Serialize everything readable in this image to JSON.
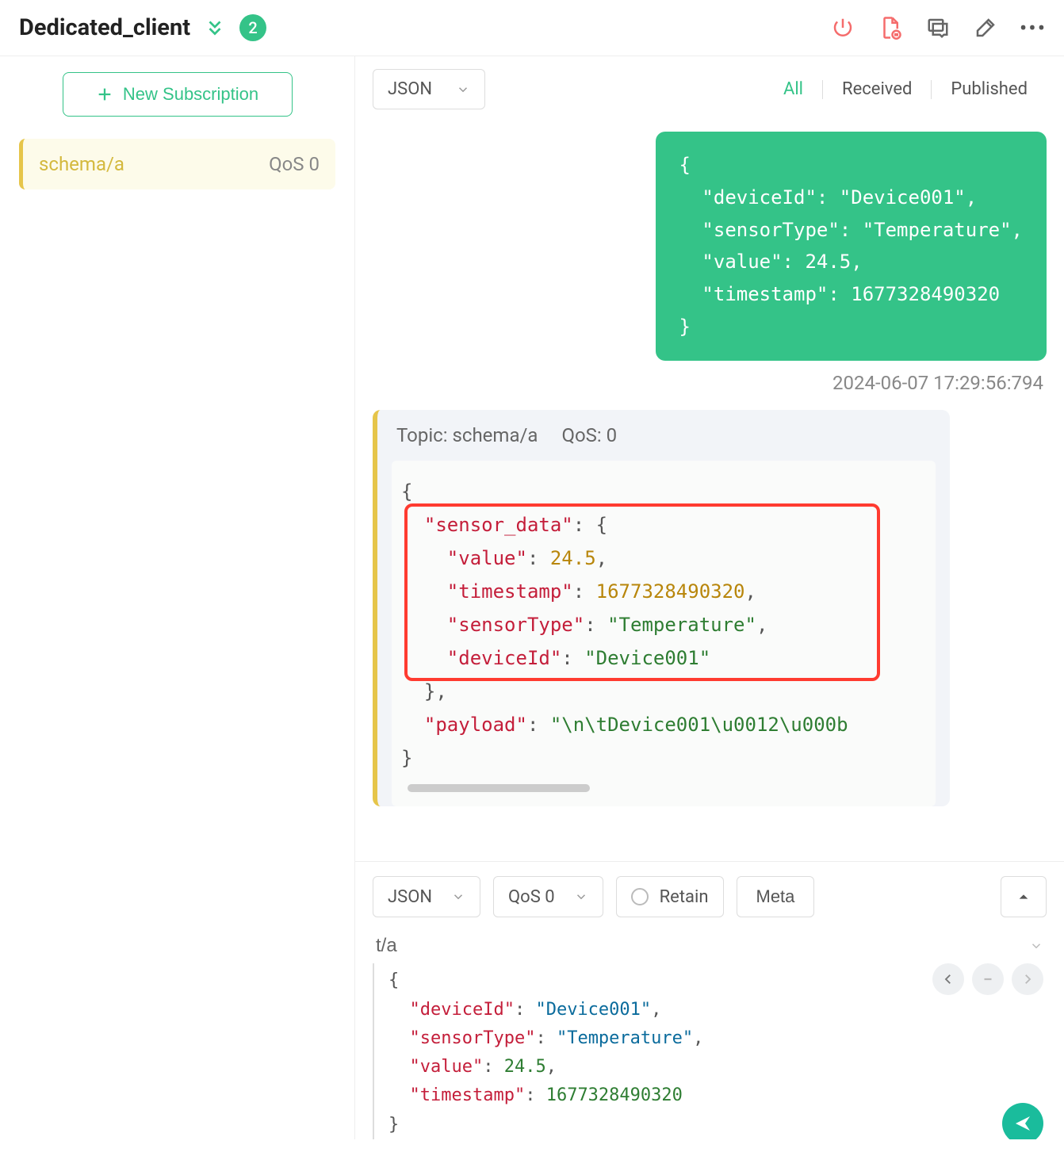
{
  "header": {
    "title": "Dedicated_client",
    "badge": "2"
  },
  "sidebar": {
    "new_subscription": "New Subscription",
    "items": [
      {
        "topic": "schema/a",
        "qos": "QoS 0"
      }
    ]
  },
  "content": {
    "format_select": "JSON",
    "tabs": {
      "all": "All",
      "received": "Received",
      "published": "Published"
    }
  },
  "messages": {
    "sent": {
      "body": "{\n  \"deviceId\": \"Device001\",\n  \"sensorType\": \"Temperature\",\n  \"value\": 24.5,\n  \"timestamp\": 1677328490320\n}",
      "timestamp": "2024-06-07 17:29:56:794"
    },
    "received": {
      "topic_label": "Topic: ",
      "topic_value": "schema/a",
      "qos_label": "QoS: ",
      "qos_value": "0",
      "json": {
        "sensor_data_key": "\"sensor_data\"",
        "value_key": "\"value\"",
        "value_num": "24.5",
        "timestamp_key": "\"timestamp\"",
        "timestamp_num": "1677328490320",
        "sensorType_key": "\"sensorType\"",
        "sensorType_val": "\"Temperature\"",
        "deviceId_key": "\"deviceId\"",
        "deviceId_val": "\"Device001\"",
        "payload_key": "\"payload\"",
        "payload_val": "\"\\n\\tDevice001\\u0012\\u000b"
      }
    }
  },
  "composer": {
    "format": "JSON",
    "qos": "QoS 0",
    "retain": "Retain",
    "meta": "Meta",
    "topic": "t/a",
    "editor": {
      "deviceId_key": "\"deviceId\"",
      "deviceId_val": "\"Device001\"",
      "sensorType_key": "\"sensorType\"",
      "sensorType_val": "\"Temperature\"",
      "value_key": "\"value\"",
      "value_num": "24.5",
      "timestamp_key": "\"timestamp\"",
      "timestamp_num": "1677328490320"
    }
  }
}
